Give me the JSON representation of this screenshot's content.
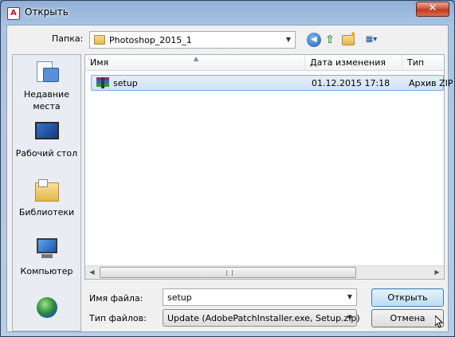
{
  "window": {
    "title": "Открыть",
    "app_icon": "adobe-icon",
    "close_label": "✕"
  },
  "toolbar": {
    "look_in_label": "Папка:",
    "look_in_value": "Photoshop_2015_1",
    "buttons": [
      "back-icon",
      "up-folder-icon",
      "new-folder-icon",
      "views-menu-icon"
    ]
  },
  "places": [
    {
      "label": "Недавние места",
      "icon": "recent-places-icon"
    },
    {
      "label": "Рабочий стол",
      "icon": "desktop-icon"
    },
    {
      "label": "Библиотеки",
      "icon": "libraries-icon"
    },
    {
      "label": "Компьютер",
      "icon": "computer-icon"
    },
    {
      "label": "",
      "icon": "network-icon"
    }
  ],
  "columns": [
    "Имя",
    "Дата изменения",
    "Тип"
  ],
  "files": [
    {
      "name": "setup",
      "date": "01.12.2015 17:18",
      "type": "Архив ZIP",
      "icon": "winrar-archive-icon",
      "selected": true
    }
  ],
  "filename": {
    "label": "Имя файла:",
    "value": "setup"
  },
  "filetype": {
    "label": "Тип файлов:",
    "value": "Update (AdobePatchInstaller.exe, Setup.zip)"
  },
  "buttons": {
    "open": "Открыть",
    "cancel": "Отмена"
  },
  "colors": {
    "selection": "#cfe3f8",
    "selection_border": "#84acdd",
    "close_button": "#c13a1e",
    "default_button": "#bcdcf5"
  }
}
